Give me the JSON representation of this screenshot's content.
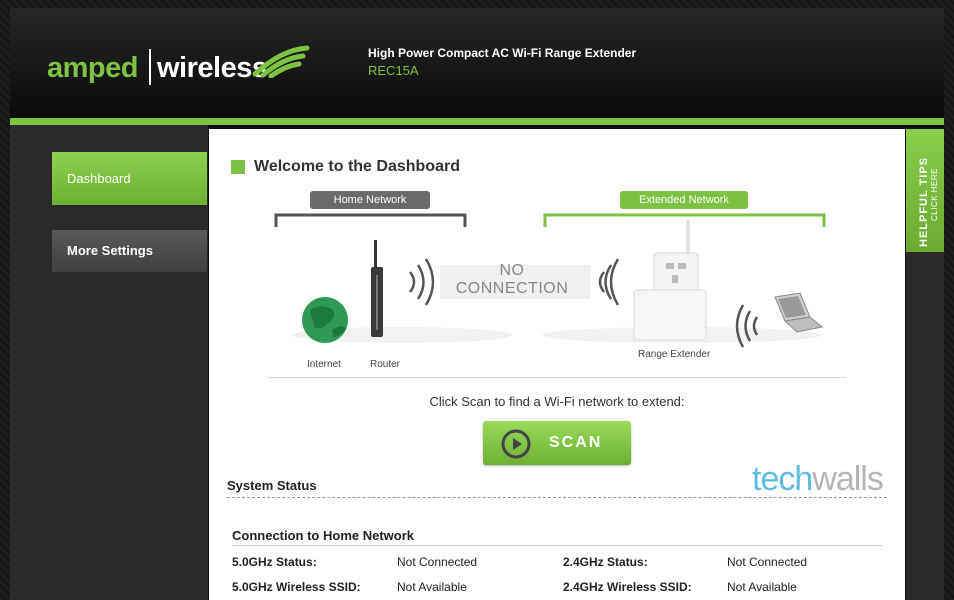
{
  "header": {
    "logo_left": "amped",
    "logo_right": "wireless",
    "product_name": "High Power Compact AC Wi-Fi Range Extender",
    "model": "REC15A"
  },
  "sidebar": {
    "items": [
      {
        "label": "Dashboard",
        "active": true
      },
      {
        "label": "More Settings",
        "active": false
      }
    ]
  },
  "tips": {
    "title": "HELPFUL TIPS",
    "subtitle": "CLICK HERE"
  },
  "dashboard": {
    "title": "Welcome to the Dashboard",
    "home_network_label": "Home Network",
    "extended_network_label": "Extended Network",
    "internet_label": "Internet",
    "router_label": "Router",
    "extender_label": "Range Extender",
    "status_line1": "NO",
    "status_line2": "CONNECTION",
    "scan_prompt": "Click Scan to find a Wi-Fi network to extend:",
    "scan_button": "SCAN"
  },
  "watermark": {
    "part1": "tech",
    "part2": "walls"
  },
  "system_status": {
    "title": "System Status",
    "section_title": "Connection to Home Network",
    "rows": [
      {
        "label_5g": "5.0GHz Status:",
        "value_5g": "Not Connected",
        "label_24g": "2.4GHz Status:",
        "value_24g": "Not Connected"
      },
      {
        "label_5g": "5.0GHz Wireless SSID:",
        "value_5g": "Not Available",
        "label_24g": "2.4GHz Wireless SSID:",
        "value_24g": "Not Available"
      }
    ]
  },
  "colors": {
    "brand_green": "#7dc242",
    "background": "#1b1b1b"
  }
}
